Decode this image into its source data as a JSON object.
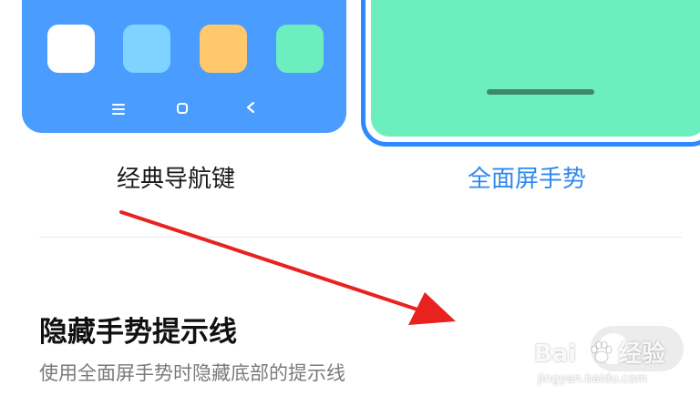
{
  "navigation_modes": {
    "classic": {
      "label": "经典导航键",
      "card_color": "#4a9cff",
      "app_tiles": [
        {
          "color": "#ffffff"
        },
        {
          "color": "#7fd3ff"
        },
        {
          "color": "#ffc96b"
        },
        {
          "color": "#6ceebe"
        }
      ],
      "nav_keys": [
        "menu-icon",
        "home-icon",
        "back-icon"
      ]
    },
    "gesture": {
      "label": "全面屏手势",
      "selected": true,
      "card_color": "#6ceebe",
      "accent": "#2f88f0"
    }
  },
  "setting": {
    "title": "隐藏手势提示线",
    "description": "使用全面屏手势时隐藏底部的提示线",
    "toggle_on": false
  },
  "annotation": {
    "arrow_color": "#e8231f"
  },
  "watermark": {
    "brand_left": "Bai",
    "brand_right": "经验",
    "url": "jingyan.baidu.com"
  }
}
